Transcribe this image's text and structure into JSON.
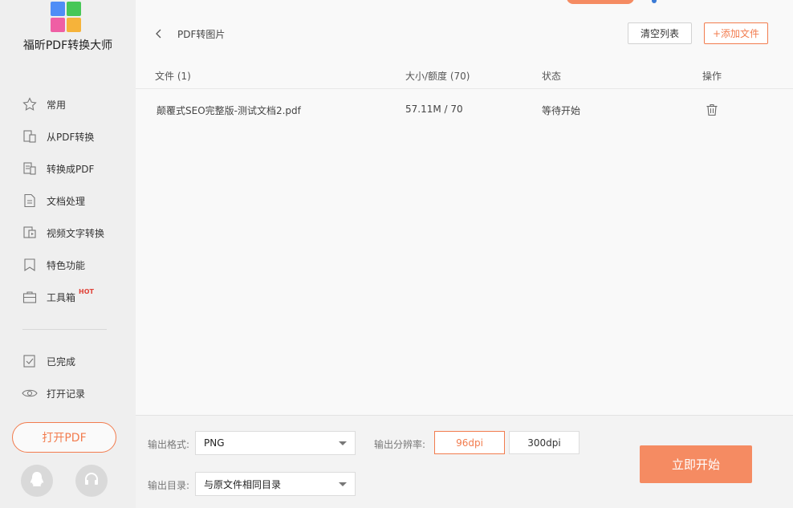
{
  "app": {
    "title": "福昕PDF转换大师"
  },
  "colors": {
    "accent": "#f27c4e",
    "start_button": "#f58b62",
    "logo": [
      "#4f8df6",
      "#47c757",
      "#ef5fa4",
      "#f6b33a"
    ]
  },
  "sidebar": {
    "items": [
      {
        "label": "常用",
        "icon": "star-icon"
      },
      {
        "label": "从PDF转换",
        "icon": "from-pdf-icon"
      },
      {
        "label": "转换成PDF",
        "icon": "to-pdf-icon"
      },
      {
        "label": "文档处理",
        "icon": "document-icon"
      },
      {
        "label": "视频文字转换",
        "icon": "video-text-icon"
      },
      {
        "label": "特色功能",
        "icon": "bookmark-icon"
      },
      {
        "label": "工具箱",
        "icon": "toolbox-icon",
        "badge": "HOT"
      }
    ],
    "secondary": [
      {
        "label": "已完成",
        "icon": "checked-doc-icon"
      },
      {
        "label": "打开记录",
        "icon": "eye-icon"
      }
    ],
    "open_button": "打开PDF"
  },
  "header": {
    "back_label": "PDF转图片",
    "clear_button": "清空列表",
    "add_button": "+添加文件"
  },
  "table": {
    "headers": {
      "file": "文件 (1)",
      "size": "大小/额度 (70)",
      "status": "状态",
      "action": "操作"
    },
    "rows": [
      {
        "file": "颠覆式SEO完整版-测试文档2.pdf",
        "size": "57.11M / 70",
        "status": "等待开始"
      }
    ]
  },
  "options": {
    "format_label": "输出格式:",
    "format_value": "PNG",
    "resolution_label": "输出分辨率:",
    "resolution_options": [
      "96dpi",
      "300dpi"
    ],
    "resolution_selected": "96dpi",
    "dir_label": "输出目录:",
    "dir_value": "与原文件相同目录",
    "start_button": "立即开始"
  }
}
